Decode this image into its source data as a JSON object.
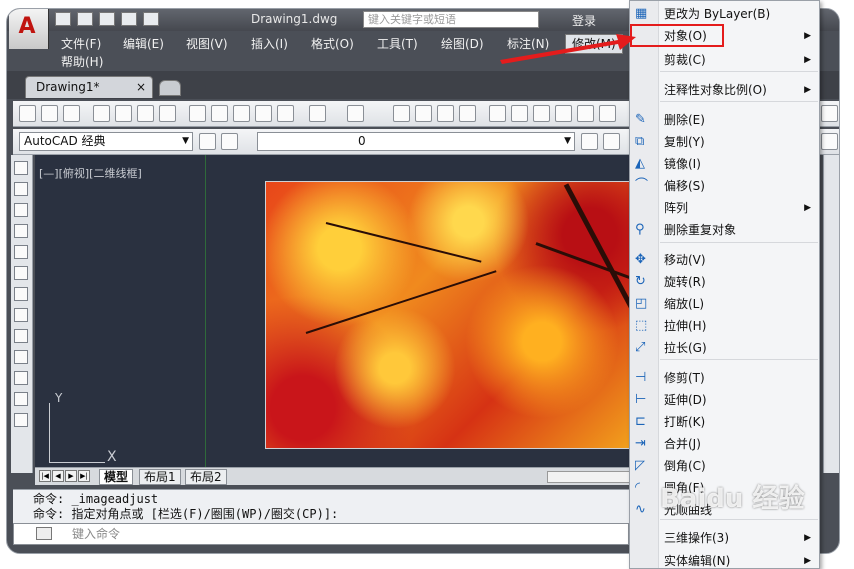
{
  "titlebar": {
    "document_title": "Drawing1.dwg",
    "search_placeholder": "键入关键字或短语",
    "login_label": "登录"
  },
  "menubar": {
    "items": [
      "文件(F)",
      "编辑(E)",
      "视图(V)",
      "插入(I)",
      "格式(O)",
      "工具(T)",
      "绘图(D)",
      "标注(N)",
      "修改(M)",
      "帮助(H)"
    ],
    "active": "修改(M)"
  },
  "tabs": {
    "document_tab": "Drawing1*",
    "close_glyph": "×"
  },
  "toolbar2": {
    "workspace": "AutoCAD 经典",
    "layer": "0"
  },
  "canvas": {
    "viewport_label": "[—][俯视][二维线框]",
    "ucs_y": "Y",
    "ucs_x": "X"
  },
  "layout_tabs": [
    "模型",
    "布局1",
    "布局2"
  ],
  "command": {
    "history_line1": "命令: _imageadjust",
    "history_line2": "命令: 指定对角点或 [栏选(F)/圈围(WP)/圈交(CP)]:",
    "input_placeholder": "键入命令"
  },
  "dropdown": {
    "items": [
      {
        "label": "更改为 ByLayer(B)",
        "icon": "bylayer-icon",
        "submenu": false
      },
      {
        "label": "对象(O)",
        "icon": "",
        "submenu": true
      },
      {
        "label": "剪裁(C)",
        "icon": "",
        "submenu": true
      },
      {
        "label": "注释性对象比例(O)",
        "icon": "",
        "submenu": true
      },
      {
        "label": "删除(E)",
        "icon": "eraser-icon",
        "submenu": false
      },
      {
        "label": "复制(Y)",
        "icon": "copy-icon",
        "submenu": false
      },
      {
        "label": "镜像(I)",
        "icon": "mirror-icon",
        "submenu": false
      },
      {
        "label": "偏移(S)",
        "icon": "offset-icon",
        "submenu": false
      },
      {
        "label": "阵列",
        "icon": "",
        "submenu": true
      },
      {
        "label": "删除重复对象",
        "icon": "overkill-icon",
        "submenu": false
      },
      {
        "label": "移动(V)",
        "icon": "move-icon",
        "submenu": false
      },
      {
        "label": "旋转(R)",
        "icon": "rotate-icon",
        "submenu": false
      },
      {
        "label": "缩放(L)",
        "icon": "scale-icon",
        "submenu": false
      },
      {
        "label": "拉伸(H)",
        "icon": "stretch-icon",
        "submenu": false
      },
      {
        "label": "拉长(G)",
        "icon": "lengthen-icon",
        "submenu": false
      },
      {
        "label": "修剪(T)",
        "icon": "trim-icon",
        "submenu": false
      },
      {
        "label": "延伸(D)",
        "icon": "extend-icon",
        "submenu": false
      },
      {
        "label": "打断(K)",
        "icon": "break-icon",
        "submenu": false
      },
      {
        "label": "合并(J)",
        "icon": "join-icon",
        "submenu": false
      },
      {
        "label": "倒角(C)",
        "icon": "chamfer-icon",
        "submenu": false
      },
      {
        "label": "圆角(F)",
        "icon": "fillet-icon",
        "submenu": false
      },
      {
        "label": "光顺曲线",
        "icon": "blend-icon",
        "submenu": false
      },
      {
        "label": "三维操作(3)",
        "icon": "",
        "submenu": true
      },
      {
        "label": "实体编辑(N)",
        "icon": "",
        "submenu": true
      }
    ],
    "highlighted": "对象(O)"
  },
  "colors": {
    "highlight_box": "#e41c1c",
    "canvas_bg": "#2a3140",
    "menu_bg": "#f4f5f7"
  },
  "watermark": "Baidu 经验"
}
